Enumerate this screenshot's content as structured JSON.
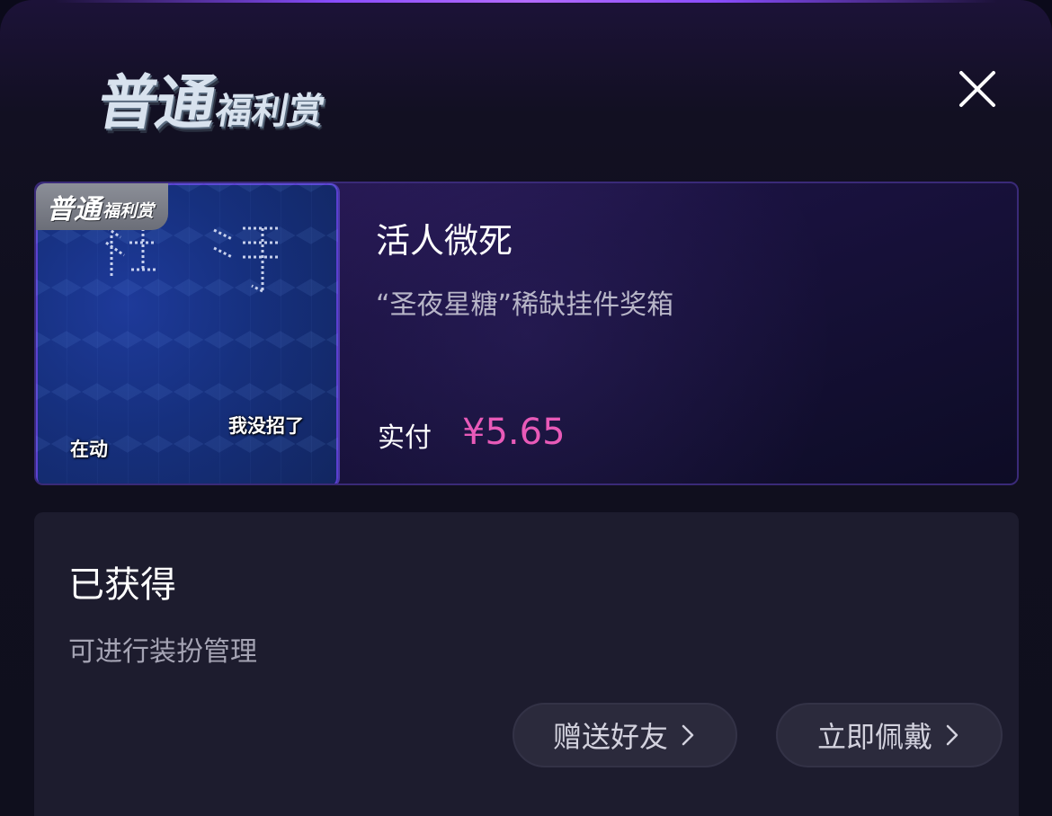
{
  "header": {
    "logo_big": "普通",
    "logo_small": "福利赏"
  },
  "item": {
    "badge_big": "普通",
    "badge_small": "福利赏",
    "thumb_texts": [
      "在动",
      "我没招了"
    ],
    "title": "活人微死",
    "subtitle": "“圣夜星糖”稀缺挂件奖箱",
    "price_label": "实付",
    "price_value": "¥5.65",
    "price_color": "#e85ab8"
  },
  "status": {
    "title": "已获得",
    "description": "可进行装扮管理",
    "gift_button": "赠送好友",
    "wear_button": "立即佩戴"
  },
  "icons": {
    "close": "close-icon",
    "chevron": "chevron-right-icon"
  }
}
